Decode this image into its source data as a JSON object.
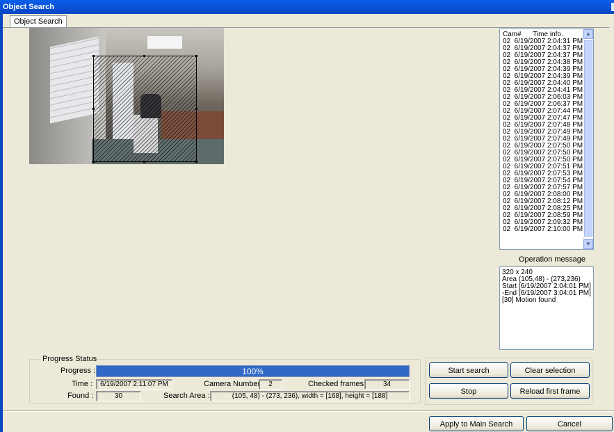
{
  "window": {
    "title": "Object Search"
  },
  "tabs": [
    {
      "label": "Object Search"
    }
  ],
  "results": {
    "header": {
      "cam": "Cam#",
      "time": "Time info."
    },
    "rows": [
      "02  6/19/2007 2:04:31 PM",
      "02  6/19/2007 2:04:37 PM",
      "02  6/19/2007 2:04:37 PM",
      "02  6/19/2007 2:04:38 PM",
      "02  6/19/2007 2:04:39 PM",
      "02  6/19/2007 2:04:39 PM",
      "02  6/19/2007 2:04:40 PM",
      "02  6/19/2007 2:04:41 PM",
      "02  6/19/2007 2:06:03 PM",
      "02  6/19/2007 2:06:37 PM",
      "02  6/19/2007 2:07:44 PM",
      "02  6/19/2007 2:07:47 PM",
      "02  6/19/2007 2:07:48 PM",
      "02  6/19/2007 2:07:49 PM",
      "02  6/19/2007 2:07:49 PM",
      "02  6/19/2007 2:07:50 PM",
      "02  6/19/2007 2:07:50 PM",
      "02  6/19/2007 2:07:50 PM",
      "02  6/19/2007 2:07:51 PM",
      "02  6/19/2007 2:07:53 PM",
      "02  6/19/2007 2:07:54 PM",
      "02  6/19/2007 2:07:57 PM",
      "02  6/19/2007 2:08:00 PM",
      "02  6/19/2007 2:08:12 PM",
      "02  6/19/2007 2:08:25 PM",
      "02  6/19/2007 2:08:59 PM",
      "02  6/19/2007 2:09:32 PM",
      "02  6/19/2007 2:10:00 PM"
    ]
  },
  "operation": {
    "label": "Operation message",
    "lines": [
      "320 x 240",
      "Area (105,48) - (273,236)",
      "Start [6/19/2007 2:04:01 PM]",
      "-End [6/19/2007 3:04:01 PM]",
      "[30] Motion found"
    ]
  },
  "progress_status": {
    "title": "Progress Status",
    "progress_label": "Progress :",
    "progress_text": "100%",
    "progress_value": 1.0,
    "time_label": "Time :",
    "time_value": "6/19/2007 2:11:07 PM",
    "camera_label": "Camera Number :",
    "camera_value": "2",
    "checked_label": "Checked frames :",
    "checked_value": "34",
    "found_label": "Found :",
    "found_value": "30",
    "area_label": "Search Area :",
    "area_value": "(105, 48) - (273, 236), width = [168], height = [188]"
  },
  "buttons": {
    "start": "Start search",
    "clear": "Clear selection",
    "stop": "Stop",
    "reload": "Reload first frame",
    "apply": "Apply to Main Search",
    "cancel": "Cancel"
  },
  "icons": {
    "scroll_up": "scroll-up-icon",
    "scroll_down": "scroll-down-icon"
  },
  "colors": {
    "titlebar": "#0a4fd6",
    "progress_fill": "#3169c6"
  }
}
